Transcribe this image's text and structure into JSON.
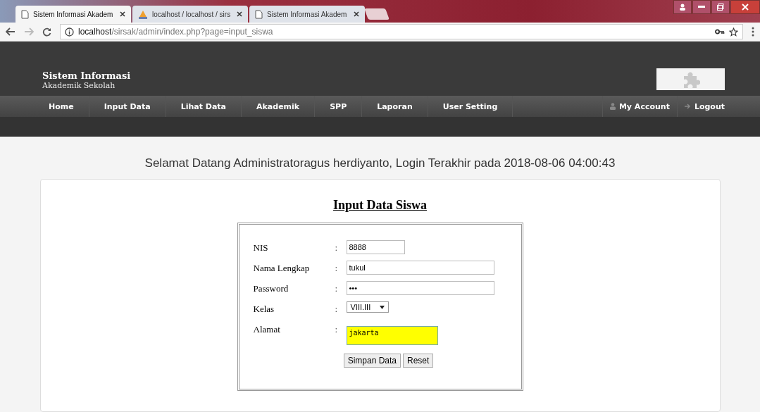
{
  "browser": {
    "tabs": [
      {
        "title": "Sistem Informasi Akadem",
        "selected": true
      },
      {
        "title": "localhost / localhost / sirs",
        "selected": false
      },
      {
        "title": "Sistem Informasi Akadem",
        "selected": false
      }
    ],
    "url_host": "localhost",
    "url_path": "/sirsak/admin/index.php?page=input_siswa"
  },
  "header": {
    "title": "Sistem Informasi",
    "subtitle": "Akademik Sekolah"
  },
  "nav": {
    "items": [
      {
        "label": "Home"
      },
      {
        "label": "Input Data"
      },
      {
        "label": "Lihat Data"
      },
      {
        "label": "Akademik"
      },
      {
        "label": "SPP"
      },
      {
        "label": "Laporan"
      },
      {
        "label": "User Setting"
      }
    ],
    "right": [
      {
        "label": "My Account"
      },
      {
        "label": "Logout"
      }
    ]
  },
  "welcome": "Selamat Datang Administratoragus herdiyanto, Login Terakhir pada 2018-08-06 04:00:43",
  "form": {
    "title": "Input Data Siswa",
    "fields": [
      {
        "label": "NIS",
        "kind": "short",
        "value": "8888"
      },
      {
        "label": "Nama Lengkap",
        "kind": "text",
        "value": "tukul"
      },
      {
        "label": "Password",
        "kind": "text",
        "value": "•••"
      },
      {
        "label": "Kelas",
        "kind": "select",
        "value": "VIII.III"
      },
      {
        "label": "Alamat",
        "kind": "textarea",
        "value": "jakarta"
      }
    ],
    "separator": ":",
    "buttons": [
      "Simpan Data",
      "Reset"
    ]
  }
}
